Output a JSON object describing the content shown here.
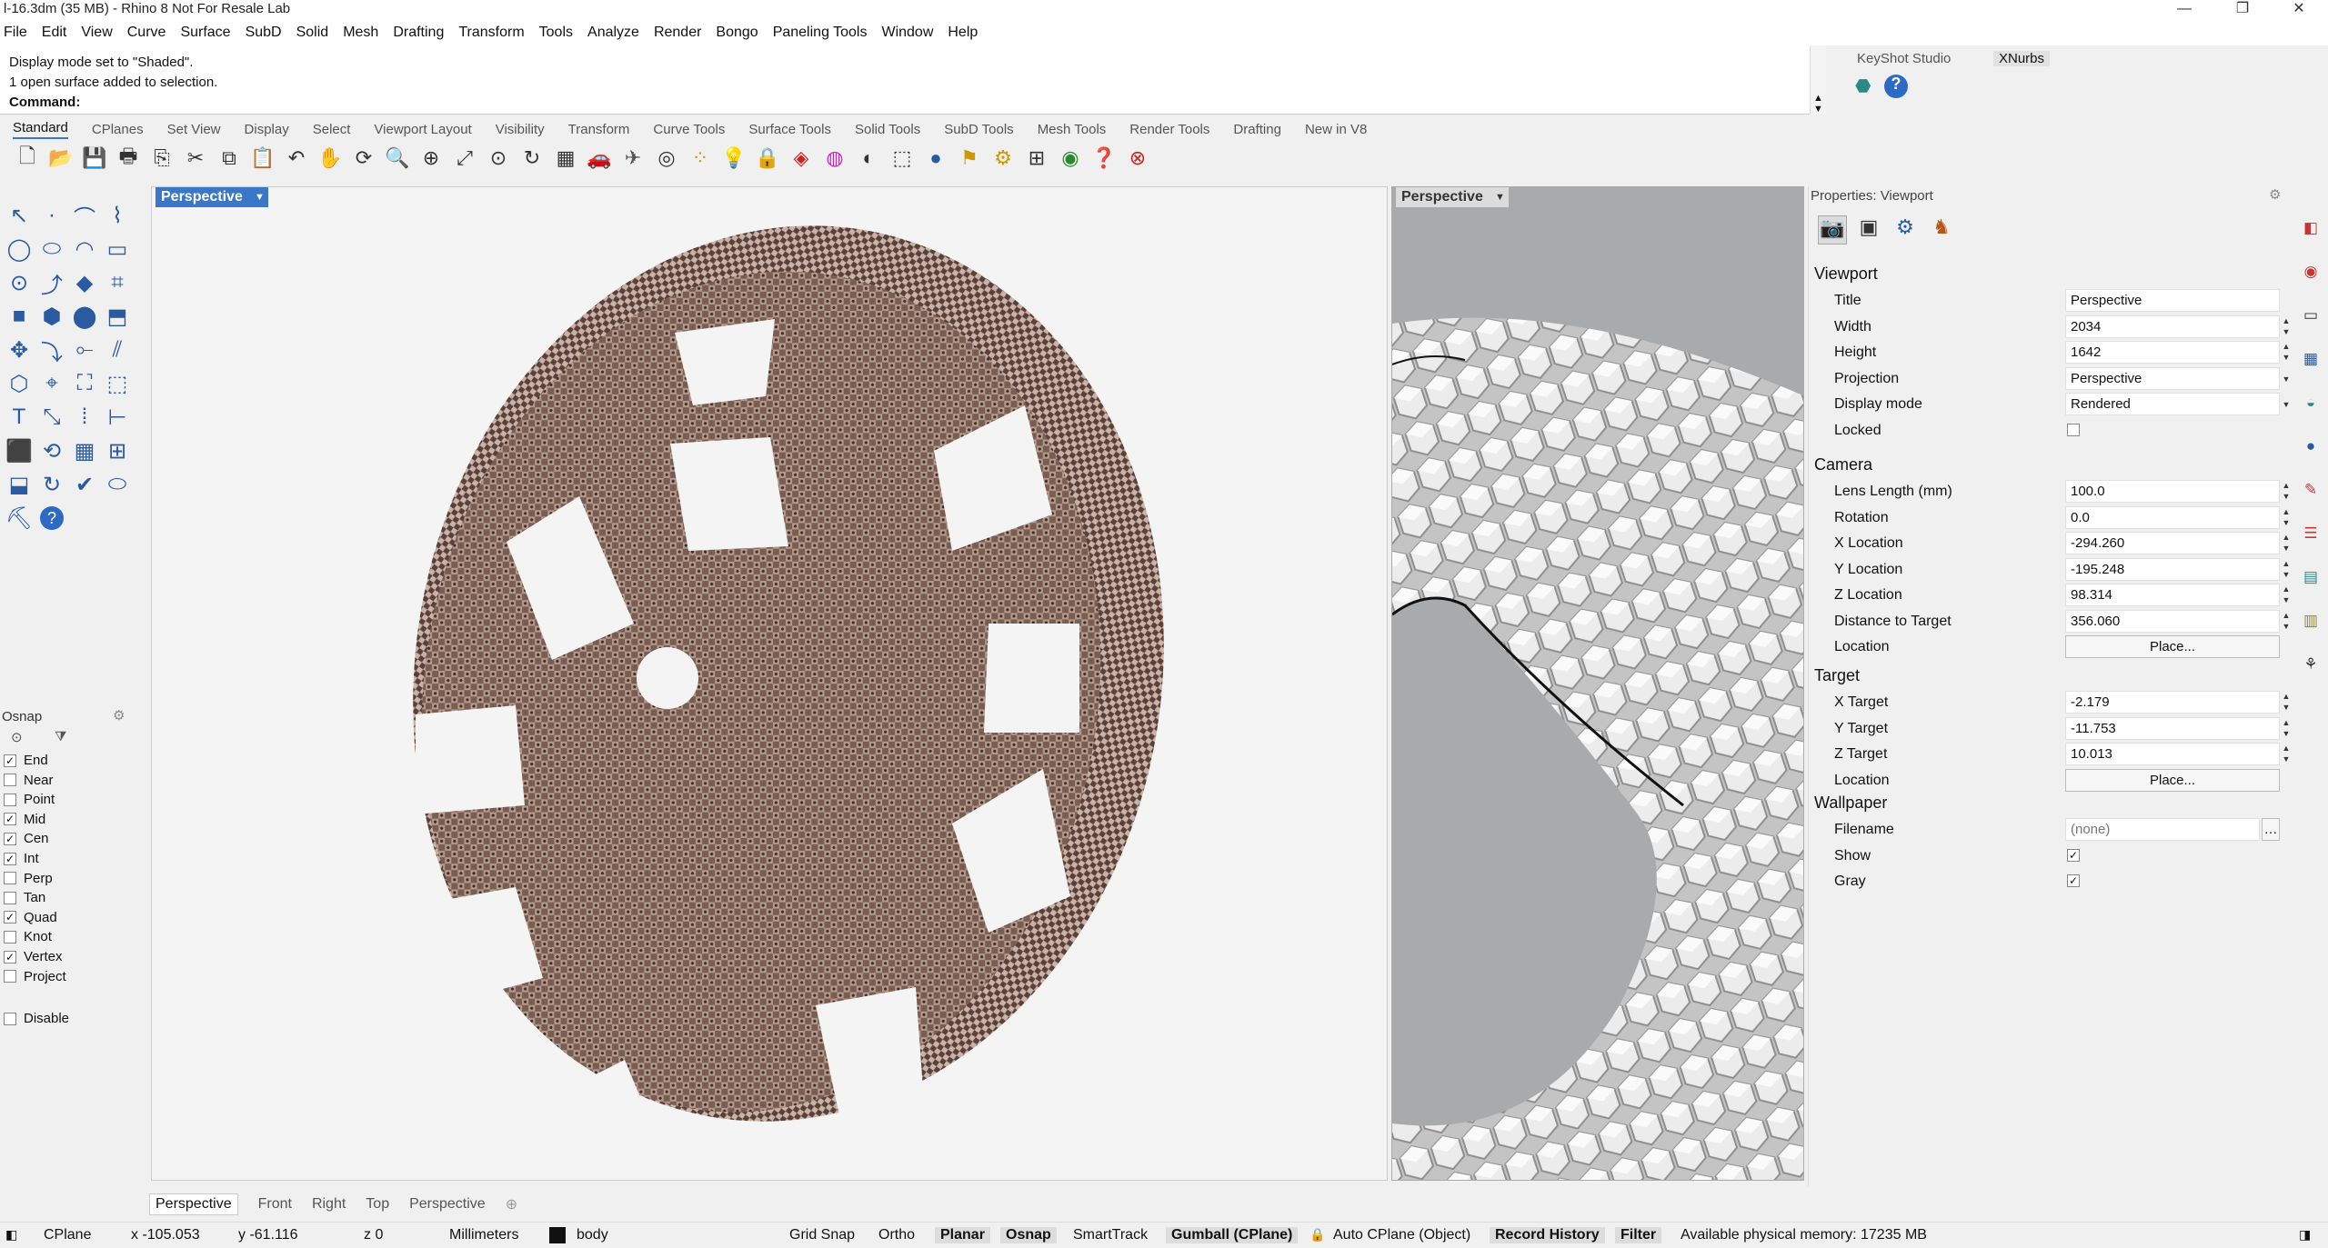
{
  "window": {
    "title": "l-16.3dm (35 MB) - Rhino 8 Not For Resale Lab",
    "controls": [
      "—",
      "❐",
      "✕"
    ]
  },
  "menu": [
    "File",
    "Edit",
    "View",
    "Curve",
    "Surface",
    "SubD",
    "Solid",
    "Mesh",
    "Drafting",
    "Transform",
    "Tools",
    "Analyze",
    "Render",
    "Bongo",
    "Paneling Tools",
    "Window",
    "Help"
  ],
  "command_history": [
    "Display mode set to \"Shaded\".",
    "1 open surface added to selection."
  ],
  "command_prompt": "Command:",
  "right_top_tabs": [
    "KeyShot Studio",
    "XNurbs"
  ],
  "toolbar_tabs": [
    "Standard",
    "CPlanes",
    "Set View",
    "Display",
    "Select",
    "Viewport Layout",
    "Visibility",
    "Transform",
    "Curve Tools",
    "Surface Tools",
    "Solid Tools",
    "SubD Tools",
    "Mesh Tools",
    "Render Tools",
    "Drafting",
    "New in V8"
  ],
  "toolbar_icons": [
    "new-icon",
    "open-icon",
    "save-icon",
    "print-icon",
    "import-icon",
    "cut-icon",
    "copy-icon",
    "paste-icon",
    "undo-icon",
    "pan-icon",
    "rotate-view-icon",
    "zoom-icon",
    "zoom-window-icon",
    "zoom-extents-icon",
    "zoom-selected-icon",
    "rotate-icon",
    "grid-icon",
    "car-icon",
    "plane-icon",
    "circle-point-icon",
    "select-points-icon",
    "light-icon",
    "lock-icon",
    "material-icon",
    "color-wheel-icon",
    "sphere-icon",
    "display-icon",
    "render-sphere-icon",
    "flag-icon",
    "gear-icon",
    "dimension-icon",
    "globe-icon",
    "help-icon",
    "render-icon"
  ],
  "osnap": {
    "title": "Osnap",
    "items": [
      {
        "label": "End",
        "checked": true
      },
      {
        "label": "Near",
        "checked": false
      },
      {
        "label": "Point",
        "checked": false
      },
      {
        "label": "Mid",
        "checked": true
      },
      {
        "label": "Cen",
        "checked": true
      },
      {
        "label": "Int",
        "checked": true
      },
      {
        "label": "Perp",
        "checked": false
      },
      {
        "label": "Tan",
        "checked": false
      },
      {
        "label": "Quad",
        "checked": true
      },
      {
        "label": "Knot",
        "checked": false
      },
      {
        "label": "Vertex",
        "checked": true
      },
      {
        "label": "Project",
        "checked": false
      }
    ],
    "disable": "Disable"
  },
  "viewport_main": {
    "label": "Perspective"
  },
  "viewport_right": {
    "label": "Perspective"
  },
  "properties": {
    "header": "Properties: Viewport",
    "viewport": {
      "section": "Viewport",
      "rows": [
        {
          "label": "Title",
          "value": "Perspective"
        },
        {
          "label": "Width",
          "value": "2034"
        },
        {
          "label": "Height",
          "value": "1642"
        },
        {
          "label": "Projection",
          "value": "Perspective"
        },
        {
          "label": "Display mode",
          "value": "Rendered"
        },
        {
          "label": "Locked",
          "value": ""
        }
      ]
    },
    "camera": {
      "section": "Camera",
      "rows": [
        {
          "label": "Lens Length (mm)",
          "value": "100.0"
        },
        {
          "label": "Rotation",
          "value": "0.0"
        },
        {
          "label": "X Location",
          "value": "-294.260"
        },
        {
          "label": "Y Location",
          "value": "-195.248"
        },
        {
          "label": "Z Location",
          "value": "98.314"
        },
        {
          "label": "Distance to Target",
          "value": "356.060"
        },
        {
          "label": "Location",
          "value": "Place..."
        }
      ]
    },
    "target": {
      "section": "Target",
      "rows": [
        {
          "label": "X Target",
          "value": "-2.179"
        },
        {
          "label": "Y Target",
          "value": "-11.753"
        },
        {
          "label": "Z Target",
          "value": "10.013"
        },
        {
          "label": "Location",
          "value": "Place..."
        }
      ]
    },
    "wallpaper": {
      "section": "Wallpaper",
      "rows": [
        {
          "label": "Filename",
          "value": "(none)"
        },
        {
          "label": "Show",
          "value": ""
        },
        {
          "label": "Gray",
          "value": ""
        }
      ]
    }
  },
  "viewport_tabs": [
    "Perspective",
    "Front",
    "Right",
    "Top",
    "Perspective"
  ],
  "status": {
    "cplane": "CPlane",
    "x": "x -105.053",
    "y": "y -61.116",
    "z": "z 0",
    "units": "Millimeters",
    "layer": "body",
    "grid_snap": "Grid Snap",
    "ortho": "Ortho",
    "planar": "Planar",
    "osnap": "Osnap",
    "smarttrack": "SmartTrack",
    "gumball": "Gumball (CPlane)",
    "autocplane": "Auto CPlane (Object)",
    "record_history": "Record History",
    "filter": "Filter",
    "memory": "Available physical memory: 17235 MB"
  },
  "colors": {
    "accent": "#3a77c8",
    "wheel": "#7a5d52",
    "wheel_light": "#b59a8c",
    "mesh_gray": "#d6d6d6"
  }
}
